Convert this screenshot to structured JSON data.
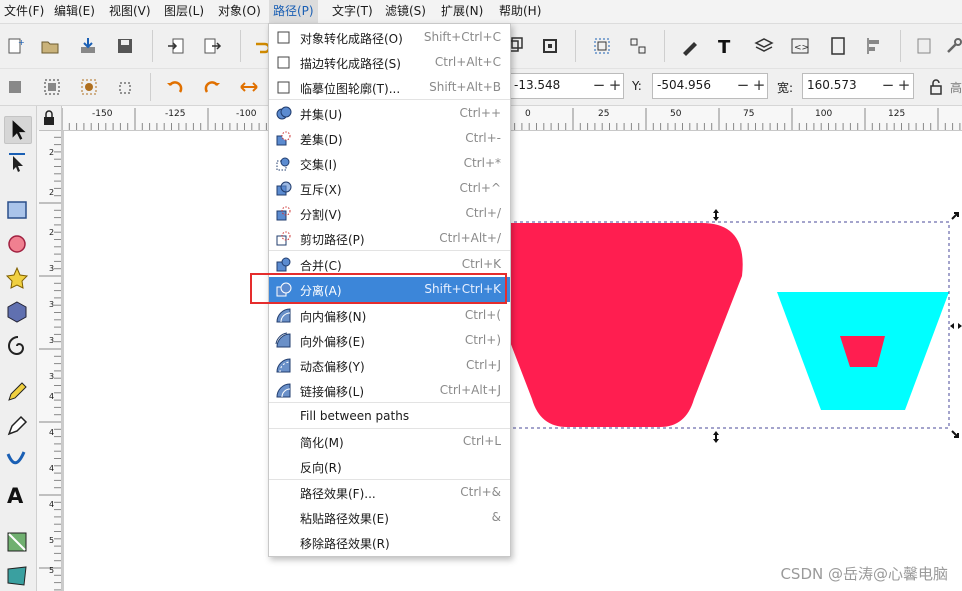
{
  "menubar": {
    "items": [
      {
        "label": "文件(F)"
      },
      {
        "label": "编辑(E)"
      },
      {
        "label": "视图(V)"
      },
      {
        "label": "图层(L)"
      },
      {
        "label": "对象(O)"
      },
      {
        "label": "路径(P)",
        "active": true
      },
      {
        "label": "文字(T)"
      },
      {
        "label": "滤镜(S)"
      },
      {
        "label": "扩展(N)"
      },
      {
        "label": "帮助(H)"
      }
    ]
  },
  "coords": {
    "x_value": "-13.548",
    "y_label": "Y:",
    "y_value": "-504.956",
    "w_label": "宽:",
    "w_value": "160.573"
  },
  "ruler": {
    "h_ticks": [
      "-150",
      "-125",
      "-100",
      "0",
      "25",
      "50",
      "75",
      "100",
      "125"
    ],
    "v_ticks": [
      "2",
      "2",
      "2",
      "3",
      "3",
      "3",
      "3",
      "4",
      "4",
      "4",
      "4",
      "5",
      "5"
    ]
  },
  "path_menu": {
    "items": [
      {
        "icon": "object-to-path-icon",
        "label": "对象转化成路径(O)",
        "shortcut": "Shift+Ctrl+C"
      },
      {
        "icon": "stroke-to-path-icon",
        "label": "描边转化成路径(S)",
        "shortcut": "Ctrl+Alt+C"
      },
      {
        "icon": "trace-bitmap-icon",
        "label": "临摹位图轮廓(T)...",
        "shortcut": "Shift+Alt+B"
      },
      {
        "icon": "union-icon",
        "label": "并集(U)",
        "shortcut": "Ctrl++"
      },
      {
        "icon": "difference-icon",
        "label": "差集(D)",
        "shortcut": "Ctrl+-"
      },
      {
        "icon": "intersection-icon",
        "label": "交集(I)",
        "shortcut": "Ctrl+*"
      },
      {
        "icon": "exclusion-icon",
        "label": "互斥(X)",
        "shortcut": "Ctrl+^"
      },
      {
        "icon": "division-icon",
        "label": "分割(V)",
        "shortcut": "Ctrl+/"
      },
      {
        "icon": "cut-path-icon",
        "label": "剪切路径(P)",
        "shortcut": "Ctrl+Alt+/"
      },
      {
        "icon": "combine-icon",
        "label": "合并(C)",
        "shortcut": "Ctrl+K"
      },
      {
        "icon": "break-apart-icon",
        "label": "分离(A)",
        "shortcut": "Shift+Ctrl+K",
        "highlighted": true
      },
      {
        "icon": "inset-icon",
        "label": "向内偏移(N)",
        "shortcut": "Ctrl+("
      },
      {
        "icon": "outset-icon",
        "label": "向外偏移(E)",
        "shortcut": "Ctrl+)"
      },
      {
        "icon": "dynamic-offset-icon",
        "label": "动态偏移(Y)",
        "shortcut": "Ctrl+J"
      },
      {
        "icon": "linked-offset-icon",
        "label": "链接偏移(L)",
        "shortcut": "Ctrl+Alt+J"
      },
      {
        "icon": "",
        "label": "Fill between paths",
        "shortcut": ""
      },
      {
        "icon": "",
        "label": "简化(M)",
        "shortcut": "Ctrl+L"
      },
      {
        "icon": "",
        "label": "反向(R)",
        "shortcut": ""
      },
      {
        "icon": "",
        "label": "路径效果(F)...",
        "shortcut": "Ctrl+&"
      },
      {
        "icon": "",
        "label": "粘贴路径效果(E)",
        "shortcut": "&"
      },
      {
        "icon": "",
        "label": "移除路径效果(R)",
        "shortcut": ""
      }
    ]
  },
  "colors": {
    "accent": "#3c86d9",
    "red_shape": "#ff1e50",
    "cyan_shape": "#00ffff",
    "highlight_box": "#e52d2d"
  },
  "watermark": "CSDN @岳涛@心馨电脑"
}
